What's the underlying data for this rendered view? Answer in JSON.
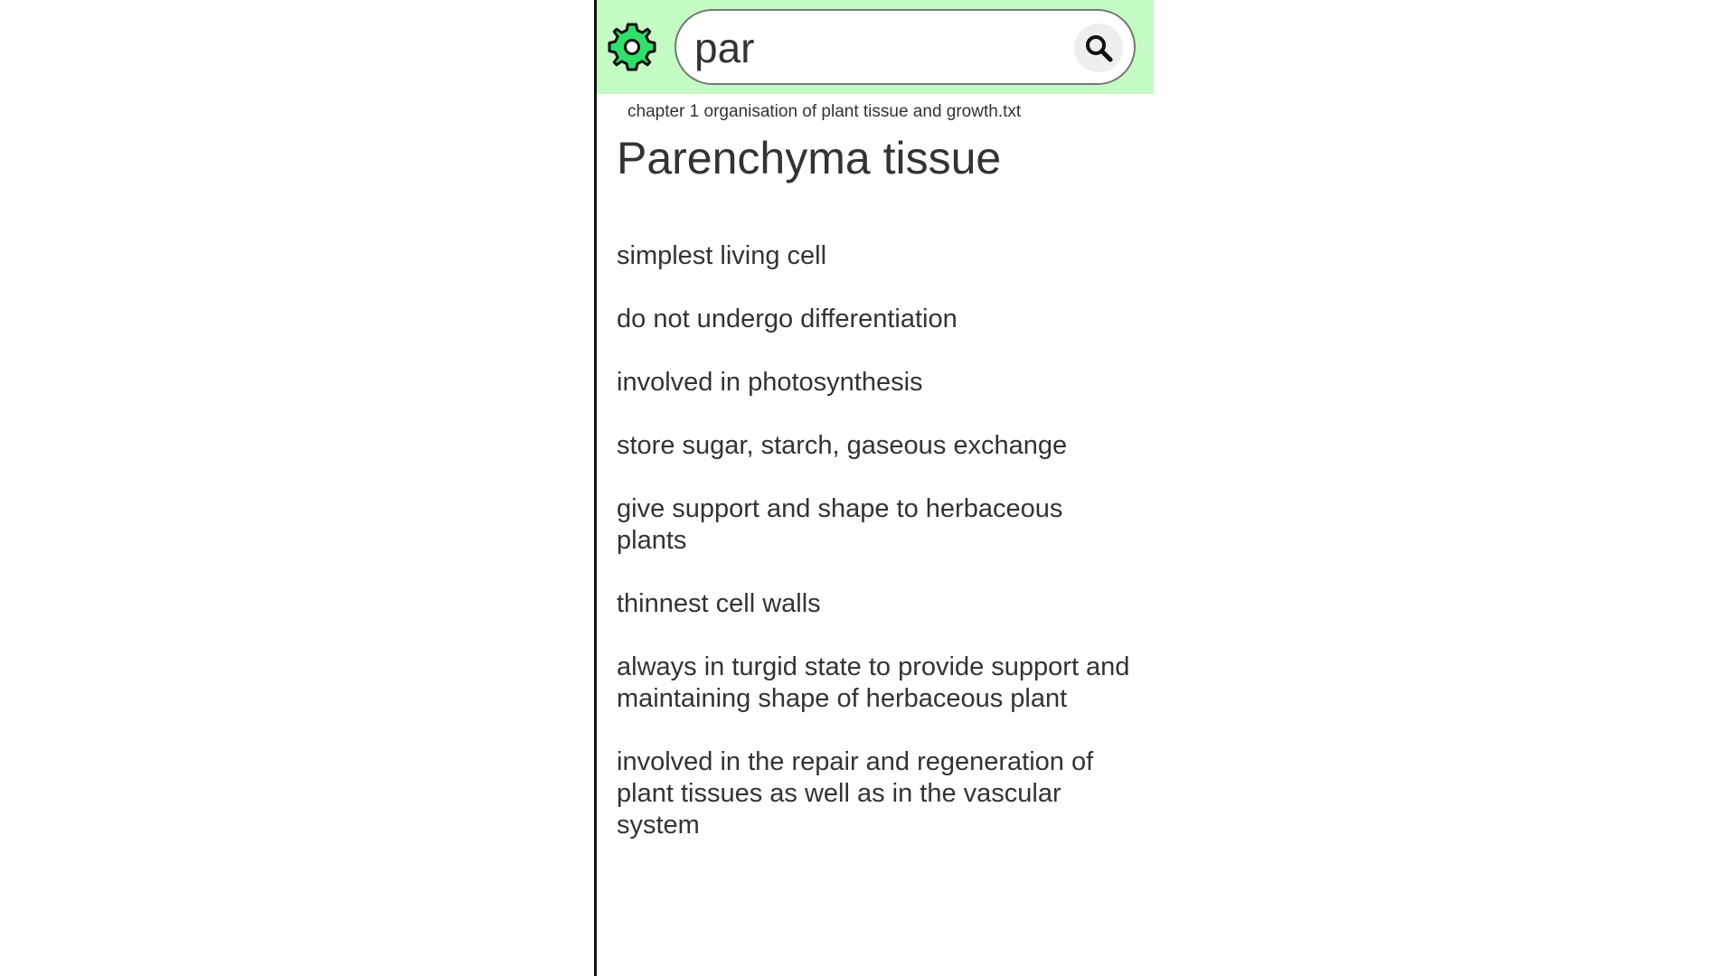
{
  "search": {
    "value": "par"
  },
  "icons": {
    "settings": "gear-icon",
    "search": "search-icon"
  },
  "colors": {
    "topbar_bg": "#c4fbc4",
    "text": "#333333"
  },
  "result": {
    "file": "chapter 1 organisation of plant tissue and growth.txt",
    "title": "Parenchyma tissue",
    "points": [
      "simplest living cell",
      "do not undergo differentiation",
      "involved in photosynthesis",
      "store sugar, starch, gaseous exchange",
      "give support and shape to herbaceous plants",
      "thinnest cell walls",
      "always in turgid state to provide support and maintaining shape of herbaceous plant",
      "involved in the repair and regeneration of plant tissues as well as in the vascular system"
    ]
  }
}
